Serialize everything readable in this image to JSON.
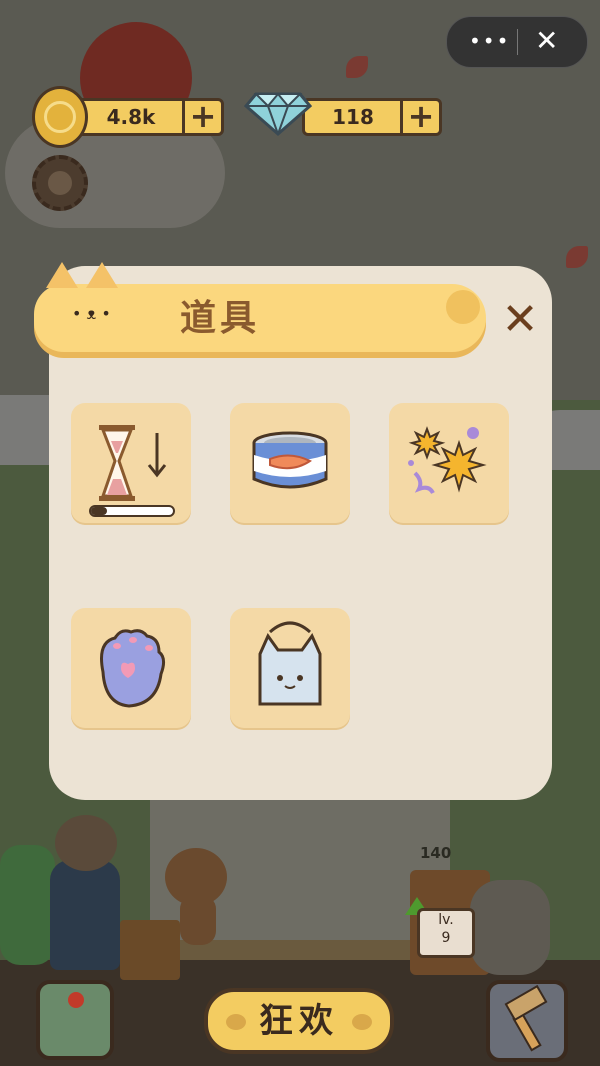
{
  "top_bar": {
    "more_icon": "more-dots-icon",
    "close_icon": "close-icon"
  },
  "currency": {
    "coins": {
      "icon": "fish-coin-icon",
      "value": "4.8k",
      "add_label": "+"
    },
    "gems": {
      "icon": "diamond-icon",
      "value": "118",
      "add_label": "+"
    }
  },
  "settings": {
    "icon": "gear-icon"
  },
  "scene": {
    "counter_value": "140",
    "level_label": "lv.",
    "level_value": "9"
  },
  "dialog": {
    "title": "道具",
    "close_label": "✕",
    "items": [
      {
        "name": "hourglass-speed-down",
        "icon": "hourglass-icon",
        "progress": 0.2
      },
      {
        "name": "fish-can",
        "icon": "fish-can-icon"
      },
      {
        "name": "firework-burst",
        "icon": "firework-icon"
      },
      {
        "name": "cat-paw-glove",
        "icon": "paw-glove-icon"
      },
      {
        "name": "cat-backpack",
        "icon": "cat-backpack-icon"
      }
    ]
  },
  "bottom_bar": {
    "map_icon": "map-icon",
    "party_label": "狂欢",
    "hammer_icon": "hammer-icon"
  },
  "colors": {
    "accent_gold": "#f3cc61",
    "panel_bg": "#ece3d4",
    "slot_bg": "#f4d9a6",
    "title_text": "#8a5a2e",
    "outline": "#4a3624"
  }
}
